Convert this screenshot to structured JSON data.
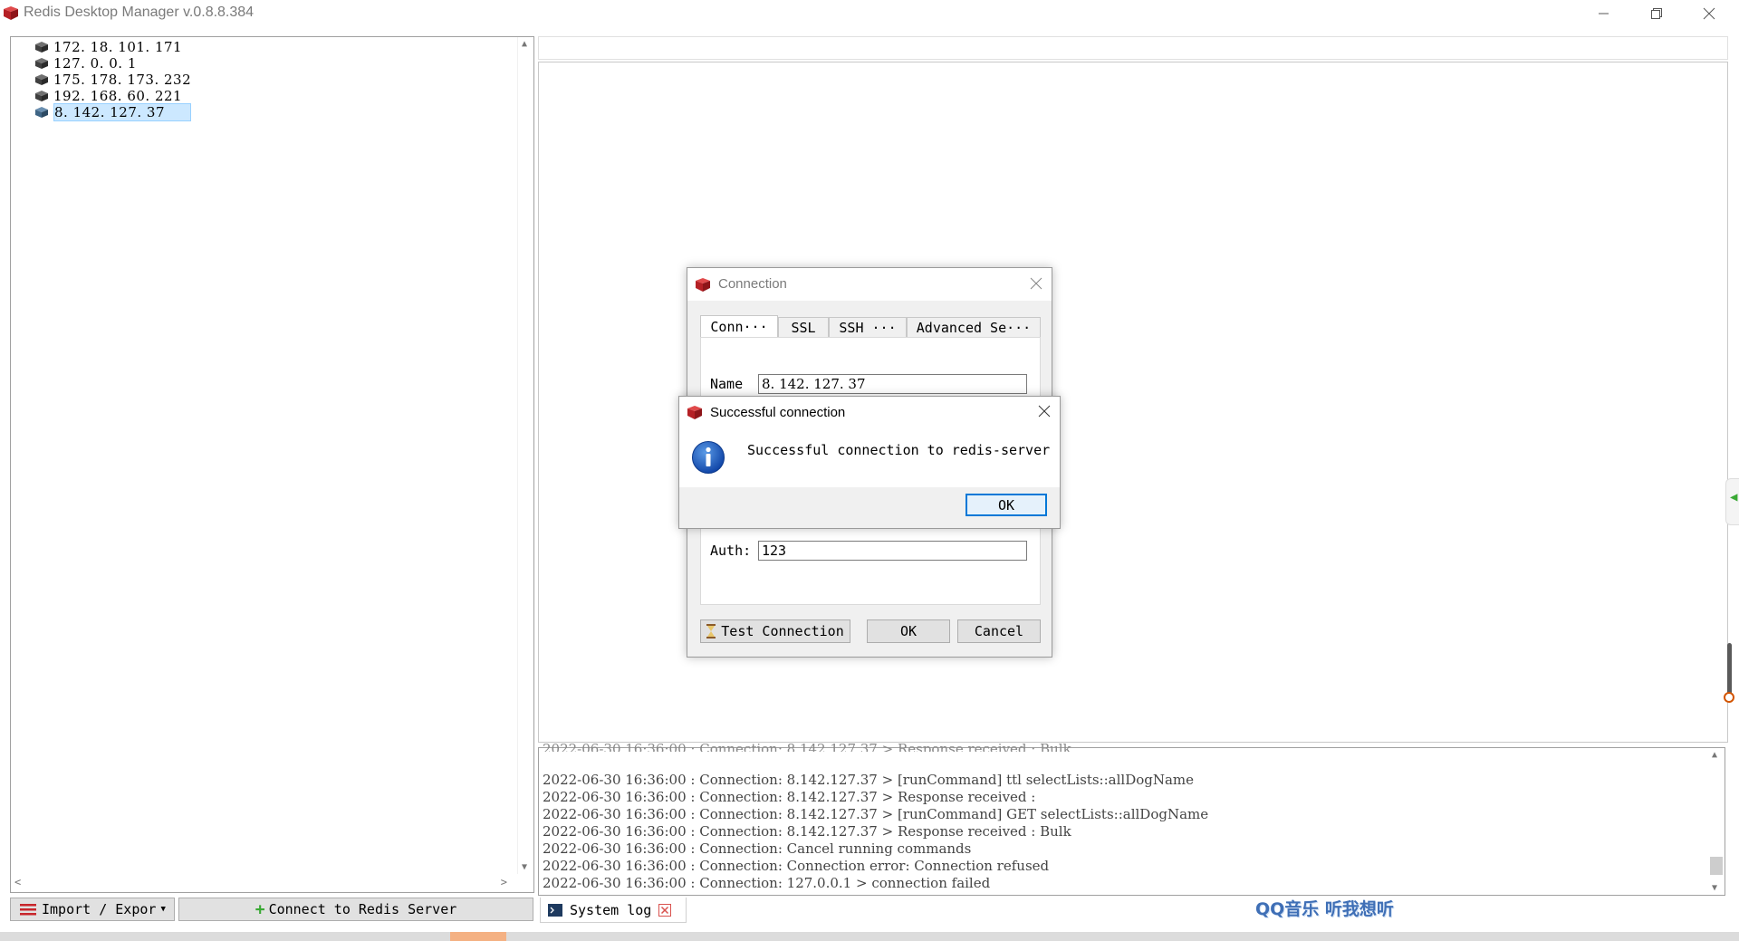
{
  "window": {
    "title": "Redis Desktop Manager v.0.8.8.384"
  },
  "servers": [
    {
      "label": "172. 18. 101. 171",
      "selected": false
    },
    {
      "label": "127. 0. 0. 1",
      "selected": false
    },
    {
      "label": "175. 178. 173. 232",
      "selected": false
    },
    {
      "label": "192. 168. 60. 221",
      "selected": false
    },
    {
      "label": "8. 142. 127. 37",
      "selected": true
    }
  ],
  "bottom_bar": {
    "import_export_label": "Import / Expor",
    "connect_label": "Connect to Redis Server",
    "system_log_tab": "System log",
    "watermark": "QQ音乐 听我想听"
  },
  "connection_dialog": {
    "title": "Connection",
    "tabs": [
      "Conn···",
      "SSL",
      "SSH ···",
      "Advanced Se···"
    ],
    "name_label": "Name",
    "name_value": "8. 142. 127. 37",
    "auth_label": "Auth:",
    "auth_value": "123",
    "test_button": "Test Connection",
    "ok_button": "OK",
    "cancel_button": "Cancel"
  },
  "message_box": {
    "title": "Successful connection",
    "message": "Successful connection to redis-server",
    "ok_button": "OK"
  },
  "log": {
    "lines": [
      "2022-06-30 16:36:00 : Connection: 8.142.127.37 > [runCommand] ttl selectLists::allDogName",
      "2022-06-30 16:36:00 : Connection: 8.142.127.37 > Response received :",
      "2022-06-30 16:36:00 : Connection: 8.142.127.37 > [runCommand] GET selectLists::allDogName",
      "2022-06-30 16:36:00 : Connection: 8.142.127.37 > Response received : Bulk",
      "2022-06-30 16:36:00 : Connection: Cancel running commands",
      "2022-06-30 16:36:00 : Connection: Connection error: Connection refused",
      "2022-06-30 16:36:00 : Connection: 127.0.0.1 > connection failed"
    ]
  },
  "colors": {
    "selection_bg": "#cce8ff",
    "redis_red": "#c8262c",
    "accent_blue": "#0078d7",
    "add_green": "#3aa935"
  }
}
